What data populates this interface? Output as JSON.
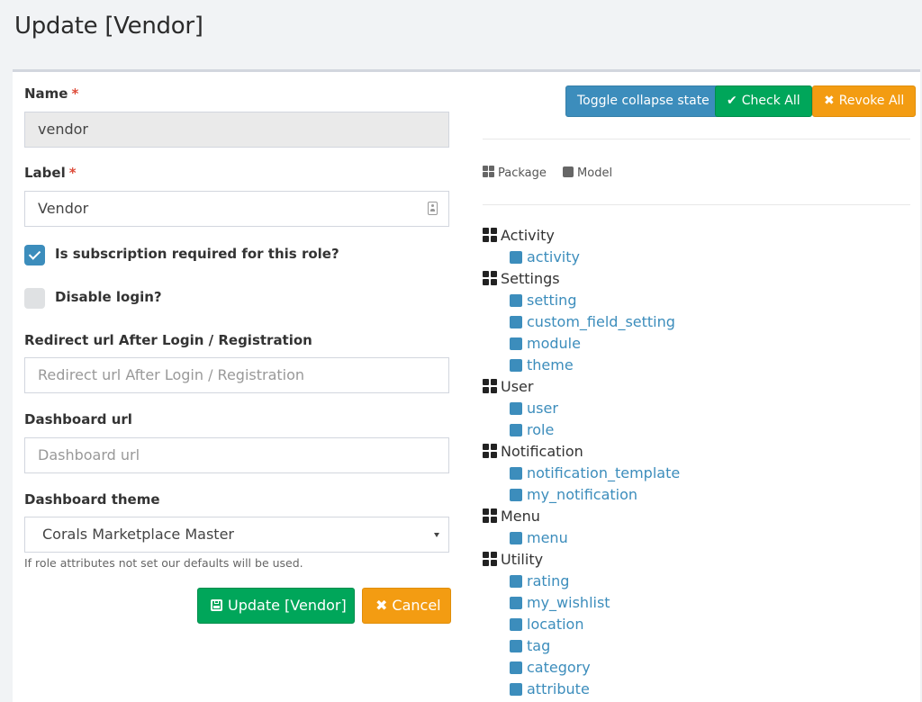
{
  "page": {
    "title": "Update [Vendor]"
  },
  "form": {
    "name": {
      "label": "Name",
      "required_mark": "*",
      "value": "vendor"
    },
    "label": {
      "label": "Label",
      "required_mark": "*",
      "value": "Vendor"
    },
    "subscription_required": {
      "label": "Is subscription required for this role?",
      "checked": true
    },
    "disable_login": {
      "label": "Disable login?",
      "checked": false
    },
    "redirect_url": {
      "label": "Redirect url After Login / Registration",
      "placeholder": "Redirect url After Login / Registration"
    },
    "dashboard_url": {
      "label": "Dashboard url",
      "placeholder": "Dashboard url"
    },
    "dashboard_theme": {
      "label": "Dashboard theme",
      "selected": "Corals Marketplace Master"
    },
    "help_text": "If role attributes not set our defaults will be used.",
    "update_button": "Update [Vendor]",
    "cancel_button": "Cancel"
  },
  "permissions": {
    "toggle_button": "Toggle collapse state",
    "check_all_button": "Check All",
    "revoke_all_button": "Revoke All",
    "legend": {
      "package": "Package",
      "model": "Model"
    },
    "tree": [
      {
        "package": "Activity",
        "models": [
          "activity"
        ]
      },
      {
        "package": "Settings",
        "models": [
          "setting",
          "custom_field_setting",
          "module",
          "theme"
        ]
      },
      {
        "package": "User",
        "models": [
          "user",
          "role"
        ]
      },
      {
        "package": "Notification",
        "models": [
          "notification_template",
          "my_notification"
        ]
      },
      {
        "package": "Menu",
        "models": [
          "menu"
        ]
      },
      {
        "package": "Utility",
        "models": [
          "rating",
          "my_wishlist",
          "location",
          "tag",
          "category",
          "attribute"
        ]
      }
    ]
  },
  "colors": {
    "primary": "#3c8dbc",
    "success": "#00a65a",
    "warning": "#f39c12",
    "danger": "#dd4b39"
  }
}
